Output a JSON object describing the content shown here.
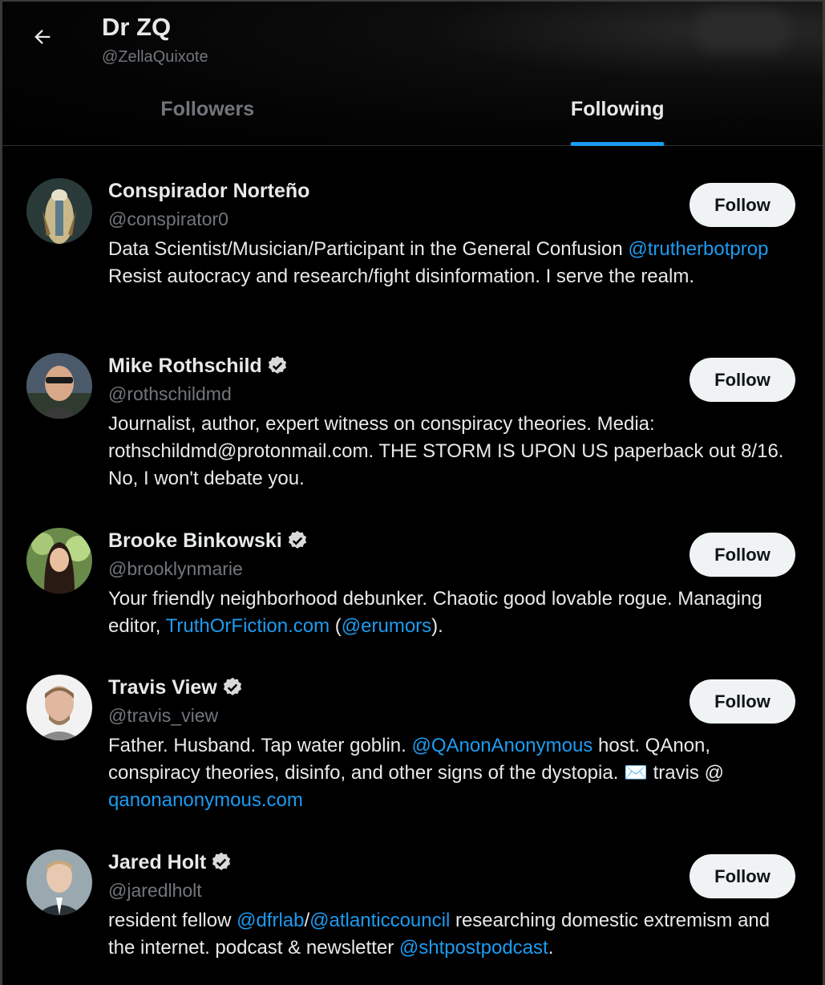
{
  "header": {
    "title": "Dr ZQ",
    "handle": "@ZellaQuixote",
    "back_icon": "arrow-left-icon"
  },
  "tabs": [
    {
      "label": "Followers",
      "active": false
    },
    {
      "label": "Following",
      "active": true
    }
  ],
  "colors": {
    "accent": "#1d9bf0",
    "background": "#000000",
    "text": "#e7e9ea",
    "muted": "#71767b",
    "button_bg": "#eff3f4"
  },
  "follow_label": "Follow",
  "users": [
    {
      "name": "Conspirador Norteño",
      "verified": false,
      "handle": "@conspirator0",
      "bio_parts": [
        {
          "text": "Data Scientist/Musician/Participant in the General Confusion "
        },
        {
          "text": "@trutherbotprop",
          "link": true
        },
        {
          "text": " Resist autocracy and research/fight disinformation. I serve the realm."
        }
      ]
    },
    {
      "name": "Mike Rothschild",
      "verified": true,
      "handle": "@rothschildmd",
      "bio_parts": [
        {
          "text": "Journalist, author, expert witness on conspiracy theories. Media: rothschildmd@protonmail.com. THE STORM IS UPON US paperback out 8/16. No, I won't debate you."
        }
      ]
    },
    {
      "name": "Brooke Binkowski",
      "verified": true,
      "handle": "@brooklynmarie",
      "bio_parts": [
        {
          "text": "Your friendly neighborhood debunker. Chaotic good lovable rogue. Managing editor, "
        },
        {
          "text": "TruthOrFiction.com",
          "link": true
        },
        {
          "text": " ("
        },
        {
          "text": "@erumors",
          "link": true
        },
        {
          "text": ")."
        }
      ]
    },
    {
      "name": "Travis View",
      "verified": true,
      "handle": "@travis_view",
      "bio_parts": [
        {
          "text": "Father. Husband. Tap water goblin. "
        },
        {
          "text": "@QAnonAnonymous",
          "link": true
        },
        {
          "text": " host. QAnon, conspiracy theories, disinfo, and other signs of the dystopia. ✉️ travis @ "
        },
        {
          "text": "qanonanonymous.com",
          "link": true
        }
      ]
    },
    {
      "name": "Jared Holt",
      "verified": true,
      "handle": "@jaredlholt",
      "bio_parts": [
        {
          "text": "resident fellow "
        },
        {
          "text": "@dfrlab",
          "link": true
        },
        {
          "text": "/"
        },
        {
          "text": "@atlanticcouncil",
          "link": true
        },
        {
          "text": " researching domestic extremism and the internet. podcast & newsletter "
        },
        {
          "text": "@shtpostpodcast",
          "link": true
        },
        {
          "text": "."
        }
      ]
    }
  ]
}
